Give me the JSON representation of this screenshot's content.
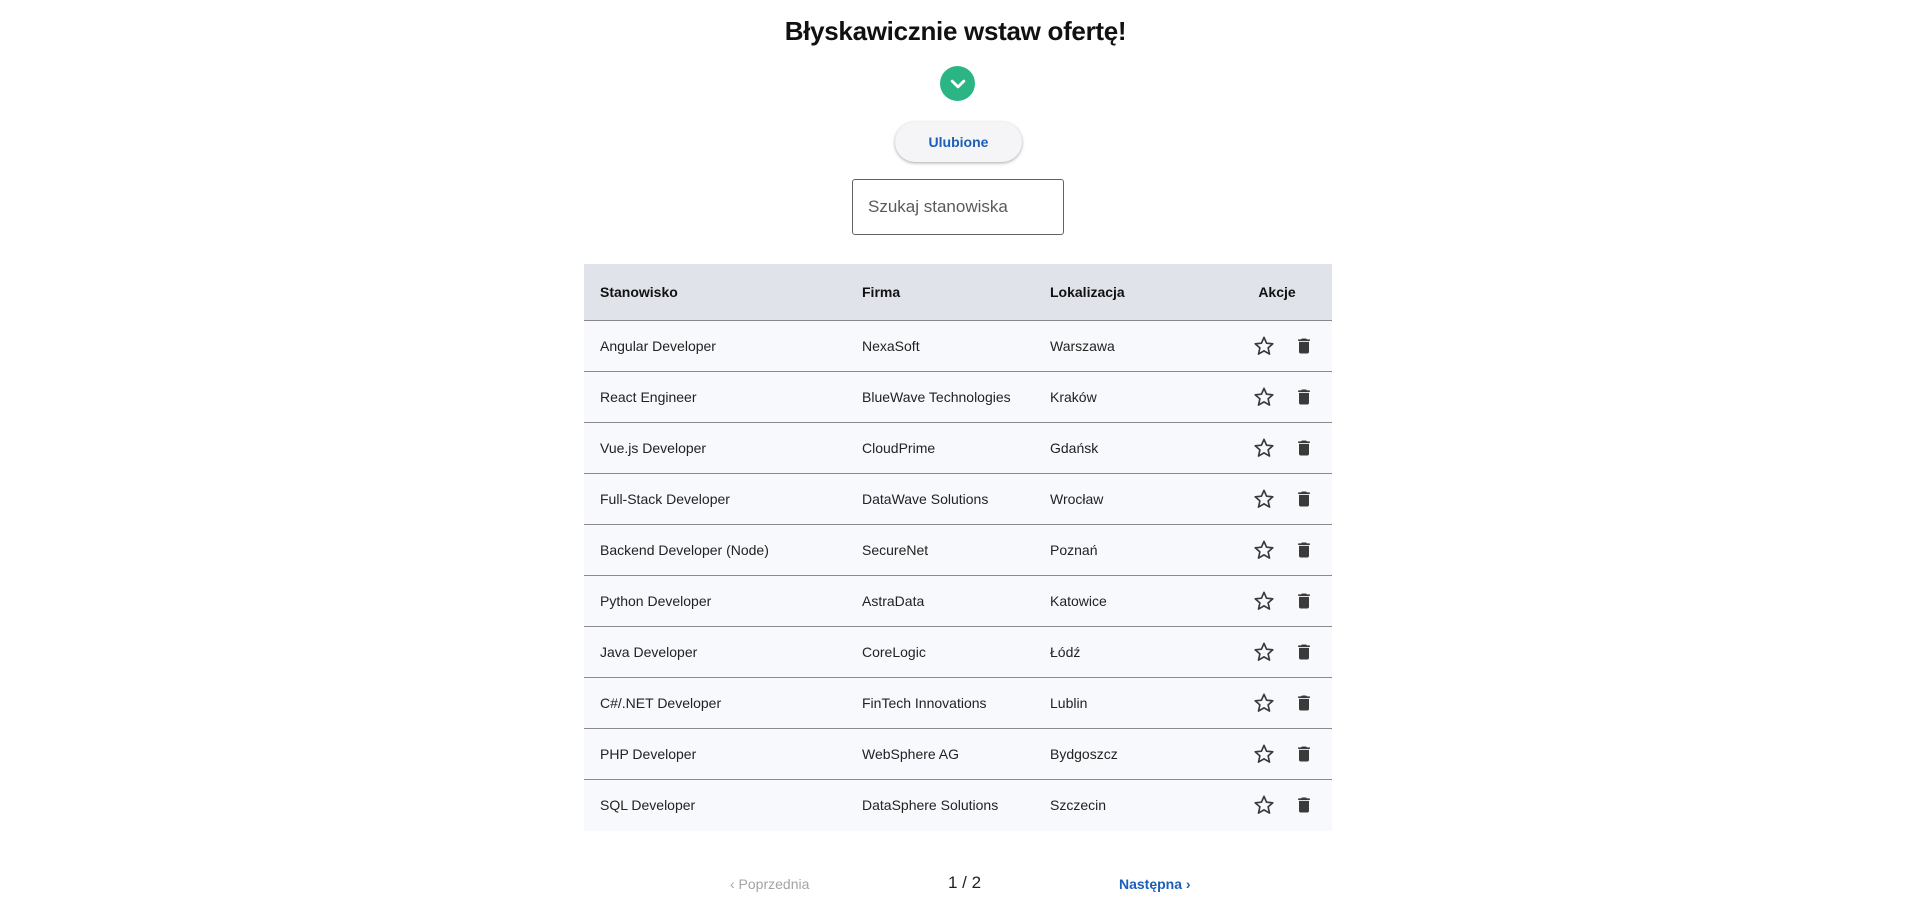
{
  "header": {
    "title": "Błyskawicznie wstaw ofertę!",
    "toggle_icon": "chevron-down-icon",
    "accent": "#2bb585"
  },
  "favorites_button": "Ulubione",
  "search": {
    "placeholder": "Szukaj stanowiska",
    "value": ""
  },
  "table": {
    "headers": [
      "Stanowisko",
      "Firma",
      "Lokalizacja",
      "Akcje"
    ],
    "rows": [
      [
        "Angular Developer",
        "NexaSoft",
        "Warszawa"
      ],
      [
        "React Engineer",
        "BlueWave Technologies",
        "Kraków"
      ],
      [
        "Vue.js Developer",
        "CloudPrime",
        "Gdańsk"
      ],
      [
        "Full-Stack Developer",
        "DataWave Solutions",
        "Wrocław"
      ],
      [
        "Backend Developer (Node)",
        "SecureNet",
        "Poznań"
      ],
      [
        "Python Developer",
        "AstraData",
        "Katowice"
      ],
      [
        "Java Developer",
        "CoreLogic",
        "Łódź"
      ],
      [
        "C#/.NET Developer",
        "FinTech Innovations",
        "Lublin"
      ],
      [
        "PHP Developer",
        "WebSphere AG",
        "Bydgoszcz"
      ],
      [
        "SQL Developer",
        "DataSphere Solutions",
        "Szczecin"
      ]
    ],
    "row_actions": [
      "star-outline-icon",
      "trash-icon"
    ]
  },
  "pagination": {
    "prev": "‹ Poprzednia",
    "page": "1 / 2",
    "next": "Następna ›",
    "link_color": "#1c5fb8",
    "disabled_color": "#a4a4a4"
  }
}
